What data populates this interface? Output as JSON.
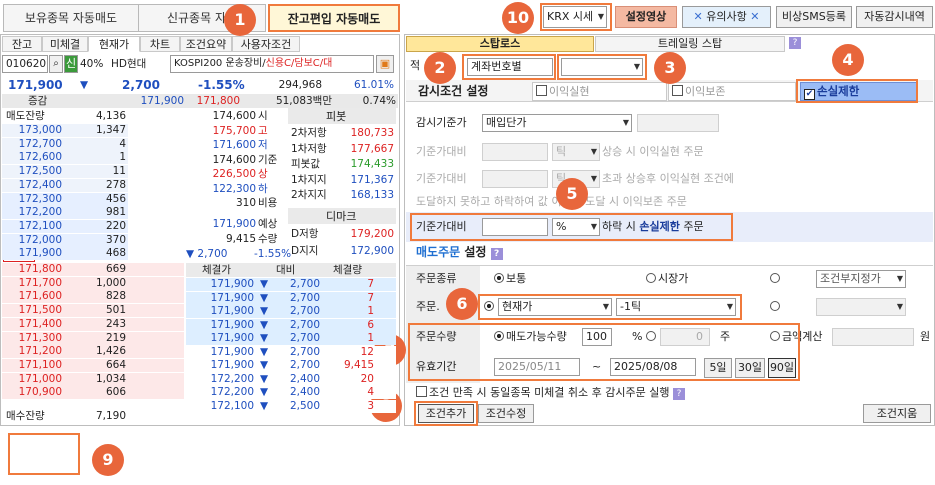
{
  "top_tabs": [
    "보유종목 자동매도",
    "신규종목 자동",
    "잔고편입 자동매도"
  ],
  "top_right": {
    "market": "KRX 시세",
    "settings_video": "설정영상",
    "caution": "유의사항",
    "sms": "비상SMS등록",
    "history": "자동감시내역"
  },
  "left_tabs": [
    "잔고",
    "미체결",
    "현재가",
    "차트",
    "조건요약",
    "사용자조건"
  ],
  "stock": {
    "code": "010620",
    "credit": "신",
    "margin": "40%",
    "name": "HD현대",
    "index_info": "KOSPI200 운송장비/",
    "credit_info": "신용C/담보C/대"
  },
  "price_bar": {
    "price": "171,900",
    "arrow": "▼",
    "change": "2,700",
    "rate": "-1.55%",
    "volume": "294,968",
    "vol_rate": "61.01%"
  },
  "bar2": {
    "label": "증감",
    "v1": "171,900",
    "v2": "171,800",
    "amount": "51,083백만",
    "pct": "0.74%"
  },
  "orderbook_header": {
    "sell_label": "매도잔량",
    "buy_label": "매수잔량",
    "sell_total": "4,136",
    "buy_total": "7,190"
  },
  "asks": [
    {
      "price": "173,000",
      "qty": "1,347"
    },
    {
      "price": "172,700",
      "qty": "4"
    },
    {
      "price": "172,600",
      "qty": "1"
    },
    {
      "price": "172,500",
      "qty": "11"
    },
    {
      "price": "172,400",
      "qty": "278"
    },
    {
      "price": "172,300",
      "qty": "456"
    },
    {
      "price": "172,200",
      "qty": "981"
    },
    {
      "price": "172,100",
      "qty": "220"
    },
    {
      "price": "172,000",
      "qty": "370"
    },
    {
      "price": "171,900",
      "qty": "468"
    }
  ],
  "bids": [
    {
      "price": "171,800",
      "qty": "669"
    },
    {
      "price": "171,700",
      "qty": "1,000"
    },
    {
      "price": "171,600",
      "qty": "828"
    },
    {
      "price": "171,500",
      "qty": "501"
    },
    {
      "price": "171,400",
      "qty": "243"
    },
    {
      "price": "171,300",
      "qty": "219"
    },
    {
      "price": "171,200",
      "qty": "1,426"
    },
    {
      "price": "171,100",
      "qty": "664"
    },
    {
      "price": "171,000",
      "qty": "1,034"
    },
    {
      "price": "170,900",
      "qty": "606"
    }
  ],
  "ohlc": [
    {
      "v": "174,600",
      "k": "시"
    },
    {
      "v": "175,700",
      "k": "고"
    },
    {
      "v": "171,600",
      "k": "저"
    },
    {
      "v": "174,600",
      "k": "기준"
    },
    {
      "v": "226,500",
      "k": "상"
    },
    {
      "v": "122,300",
      "k": "하"
    },
    {
      "v": "310",
      "k": "비용"
    }
  ],
  "pivot": {
    "title": "피봇",
    "rows": [
      {
        "k": "2차저항",
        "v": "180,733"
      },
      {
        "k": "1차저항",
        "v": "177,667"
      },
      {
        "k": "피봇값",
        "v": "174,433"
      },
      {
        "k": "1차지지",
        "v": "171,367"
      },
      {
        "k": "2차지지",
        "v": "168,133"
      }
    ]
  },
  "expect": {
    "price": "171,900",
    "label": "예상",
    "qty": "9,415",
    "qty_label": "수량",
    "change": "▼ 2,700",
    "rate": "-1.55%"
  },
  "demark": {
    "title": "디마크",
    "rows": [
      {
        "k": "D저항",
        "v": "179,200"
      },
      {
        "k": "D지지",
        "v": "172,900"
      }
    ]
  },
  "trades_header": [
    "체결가",
    "대비",
    "체결량"
  ],
  "trades": [
    {
      "p": "171,900",
      "c": "2,700",
      "q": "7"
    },
    {
      "p": "171,900",
      "c": "2,700",
      "q": "7"
    },
    {
      "p": "171,900",
      "c": "2,700",
      "q": "1"
    },
    {
      "p": "171,900",
      "c": "2,700",
      "q": "6"
    },
    {
      "p": "171,900",
      "c": "2,700",
      "q": "1"
    },
    {
      "p": "171,900",
      "c": "2,700",
      "q": "12"
    },
    {
      "p": "171,900",
      "c": "2,700",
      "q": "9,415"
    },
    {
      "p": "172,200",
      "c": "2,400",
      "q": "20"
    },
    {
      "p": "172,200",
      "c": "2,400",
      "q": "4"
    },
    {
      "p": "172,100",
      "c": "2,500",
      "q": "3"
    }
  ],
  "right": {
    "tab_stop": "스탑로스",
    "tab_trailing": "트레일링 스탑",
    "account_label": "적",
    "account_select": "계좌번호별",
    "cond_title": "감시조건 설정",
    "opt_profit": "이익실현",
    "opt_preserve": "이익보존",
    "opt_stoploss": "손실제한",
    "base_label": "감시기준가",
    "base_value": "매입단가",
    "r1_label": "기준가대비",
    "r1_unit": "틱",
    "r1_text": "상승 시 이익실현 주문",
    "r2_label": "기준가대비",
    "r2_unit": "틱",
    "r2_text": "초과 상승후 이익실현 조건에",
    "r3_text": "도달하지 못하고 하락하여  값 이하로 도달 시 이익보존 주문",
    "r4_label": "기준가대비",
    "r4_unit": "%",
    "r4_text_a": "하락 시",
    "r4_text_b": "손실제한",
    "r4_text_c": "주문",
    "sell_title": "매도주문",
    "sell_title2": "설정",
    "order_type_label": "주문종류",
    "ot_normal": "보통",
    "ot_market": "시장가",
    "ot_cond": "조건부지정가",
    "order_price_label": "주문.",
    "price_sel": "현재가",
    "tick_sel": "-1틱",
    "qty_label": "주문수량",
    "qty_radio": "매도가능수량",
    "qty_value": "100",
    "qty_unit": "%",
    "qty_zero": "0",
    "qty_shares": "주",
    "amount_label": "금액계산",
    "won": "원",
    "period_label": "유효기간",
    "date_from": "2025/05/11",
    "tilde": "~",
    "date_to": "2025/08/08",
    "d5": "5일",
    "d30": "30일",
    "d90": "90일",
    "cancel_text": "조건 만족 시 동일종목 미체결 취소 후 감시주문 실행",
    "add_btn": "조건추가",
    "edit_btn": "조건수정",
    "delete_btn": "조건지움"
  },
  "badges": [
    "1",
    "2",
    "3",
    "4",
    "5",
    "6",
    "7",
    "8",
    "9",
    "10"
  ]
}
